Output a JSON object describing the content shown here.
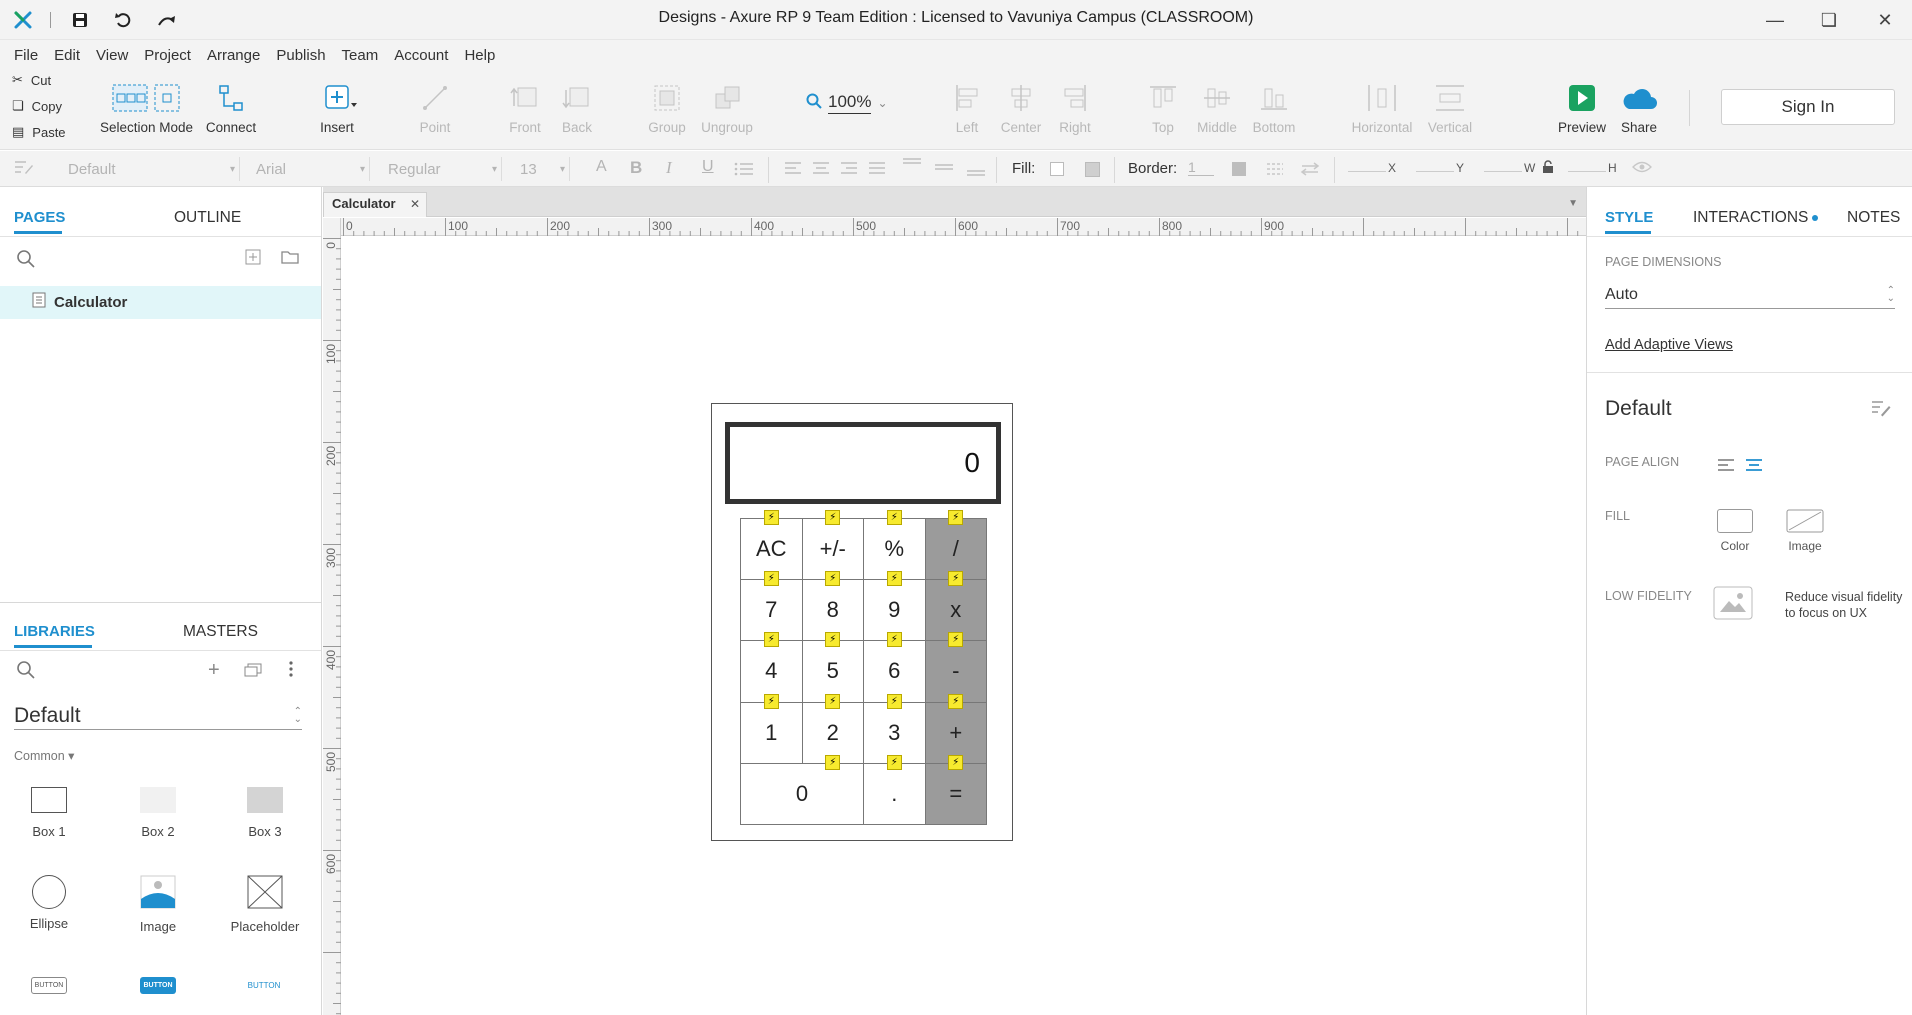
{
  "window": {
    "title": "Designs - Axure RP 9 Team Edition : Licensed to Vavuniya Campus (CLASSROOM)"
  },
  "menu": [
    "File",
    "Edit",
    "View",
    "Project",
    "Arrange",
    "Publish",
    "Team",
    "Account",
    "Help"
  ],
  "clipboard": {
    "cut": "Cut",
    "copy": "Copy",
    "paste": "Paste"
  },
  "toolbar": {
    "selection_mode": "Selection Mode",
    "connect": "Connect",
    "insert": "Insert",
    "point": "Point",
    "front": "Front",
    "back": "Back",
    "group": "Group",
    "ungroup": "Ungroup",
    "zoom": "100%",
    "left": "Left",
    "center": "Center",
    "right": "Right",
    "top": "Top",
    "middle": "Middle",
    "bottom": "Bottom",
    "horizontal": "Horizontal",
    "vertical": "Vertical",
    "preview": "Preview",
    "share": "Share",
    "sign_in": "Sign In"
  },
  "formatbar": {
    "style": "Default",
    "font": "Arial",
    "weight": "Regular",
    "size": "13",
    "fill_label": "Fill:",
    "border_label": "Border:",
    "border_value": "1",
    "x_label": "X",
    "y_label": "Y",
    "w_label": "W",
    "h_label": "H"
  },
  "left_panel": {
    "tabs": {
      "pages": "PAGES",
      "outline": "OUTLINE"
    },
    "pages": [
      {
        "label": "Calculator"
      }
    ],
    "lib_tabs": {
      "libraries": "LIBRARIES",
      "masters": "MASTERS"
    },
    "library_name": "Default",
    "section": "Common ▾",
    "widgets": [
      {
        "label": "Box 1"
      },
      {
        "label": "Box 2"
      },
      {
        "label": "Box 3"
      },
      {
        "label": "Ellipse"
      },
      {
        "label": "Image"
      },
      {
        "label": "Placeholder"
      }
    ],
    "button_widgets": [
      "BUTTON",
      "BUTTON",
      "BUTTON"
    ]
  },
  "canvas": {
    "tab_label": "Calculator",
    "ruler_h": [
      "0",
      "100",
      "200",
      "300",
      "400",
      "500",
      "600",
      "700",
      "800",
      "900"
    ],
    "ruler_v": [
      "0",
      "100",
      "200",
      "300",
      "400",
      "500",
      "600"
    ],
    "calculator": {
      "display": "0",
      "keys": [
        [
          "AC",
          "+/-",
          "%",
          "/"
        ],
        [
          "7",
          "8",
          "9",
          "x"
        ],
        [
          "4",
          "5",
          "6",
          "-"
        ],
        [
          "1",
          "2",
          "3",
          "+"
        ],
        [
          "0",
          ".",
          "="
        ]
      ]
    }
  },
  "right_panel": {
    "tabs": {
      "style": "STYLE",
      "interactions": "INTERACTIONS",
      "notes": "NOTES"
    },
    "page_dimensions_label": "PAGE DIMENSIONS",
    "page_dimensions_value": "Auto",
    "add_adaptive_views": "Add Adaptive Views",
    "style_name": "Default",
    "page_align_label": "PAGE ALIGN",
    "fill_label": "FILL",
    "fill_color": "Color",
    "fill_image": "Image",
    "low_fidelity_label": "LOW FIDELITY",
    "low_fidelity_desc": "Reduce visual fidelity to focus on UX"
  },
  "colors": {
    "accent": "#1f8fce",
    "preview_green": "#1aa260",
    "interaction_bolt": "#f7ea2e",
    "operator_key": "#9b9b9b"
  }
}
